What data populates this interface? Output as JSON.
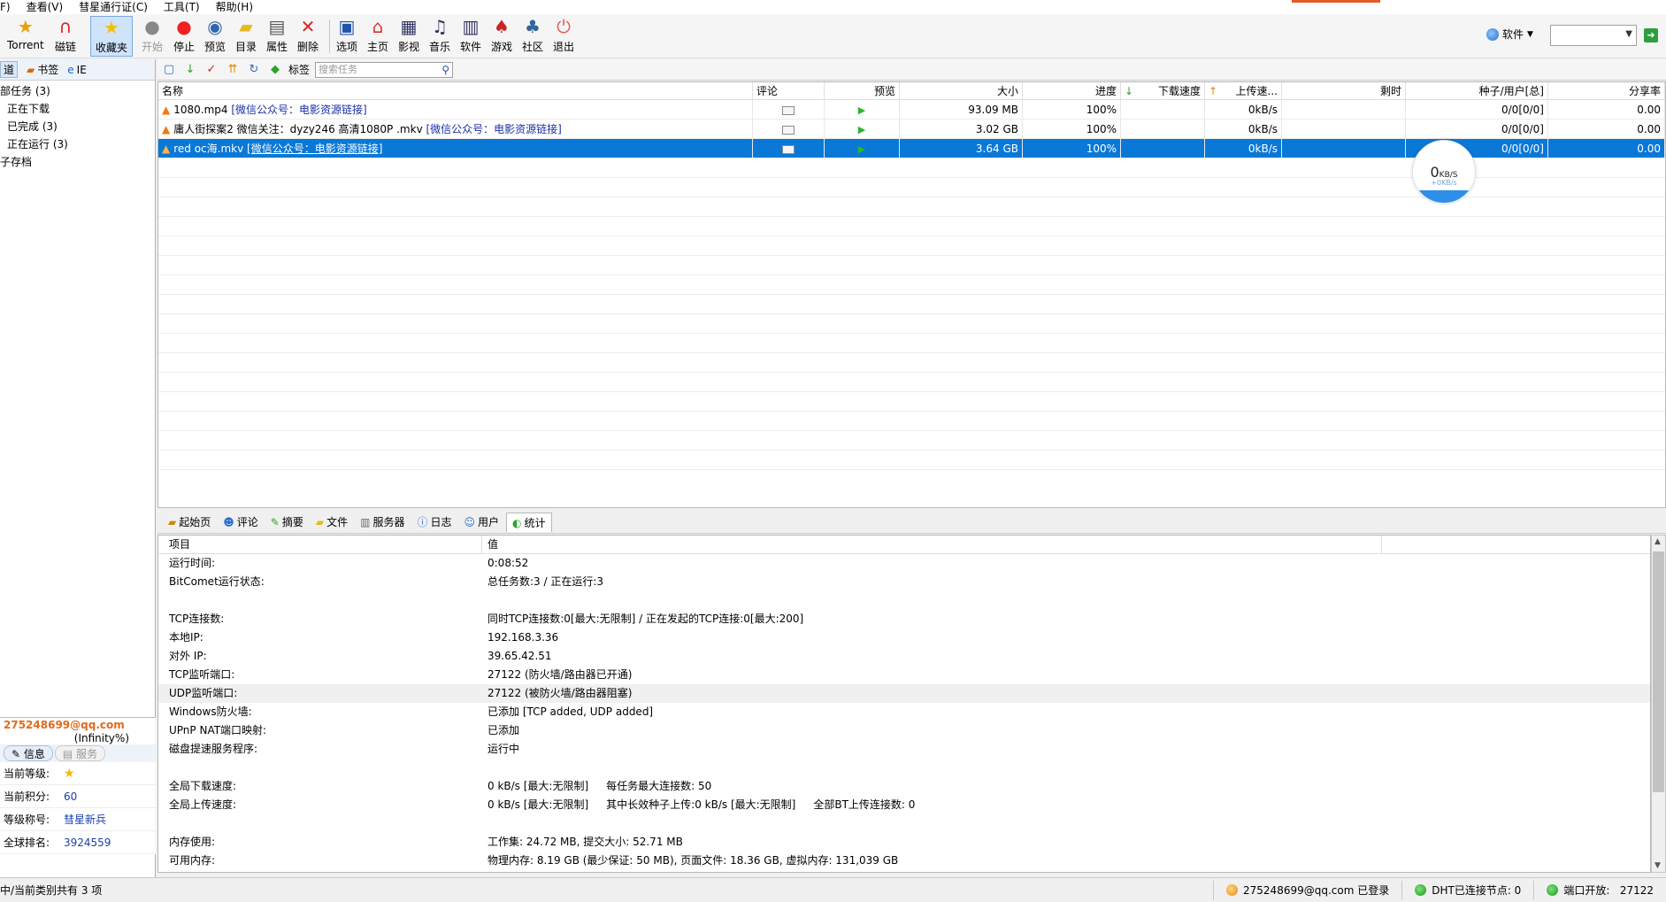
{
  "menu": {
    "items": [
      "F)",
      "查看(V)",
      "彗星通行证(C)",
      "工具(T)",
      "帮助(H)"
    ]
  },
  "toolbar": {
    "torrent": "Torrent",
    "magnet": "磁链",
    "favorites": "收藏夹",
    "start": "开始",
    "stop": "停止",
    "preview": "预览",
    "directory": "目录",
    "properties": "属性",
    "delete": "删除",
    "options": "选项",
    "home": "主页",
    "video": "影视",
    "music": "音乐",
    "software": "软件",
    "games": "游戏",
    "community": "社区",
    "exit": "退出"
  },
  "software_menu": {
    "label": "软件"
  },
  "sidebar": {
    "tabs": [
      "道",
      "书签",
      "IE"
    ],
    "tree": [
      "部任务 (3)",
      "正在下载",
      "已完成 (3)",
      "正在运行 (3)",
      "子存档"
    ]
  },
  "user": {
    "email": "275248699@qq.com",
    "infinity": "(Infinity%)",
    "tabs": {
      "info": "信息",
      "service": "服务"
    },
    "rows": [
      {
        "k": "当前等级:",
        "v": "★"
      },
      {
        "k": "当前积分:",
        "v": "60"
      },
      {
        "k": "等级称号:",
        "v": "彗星新兵"
      },
      {
        "k": "全球排名:",
        "v": "3924559"
      }
    ]
  },
  "tasktool": {
    "tags_label": "标签",
    "search_placeholder": "搜索任务"
  },
  "tasklist": {
    "columns": [
      "名称",
      "评论",
      "预览",
      "大小",
      "进度",
      "下载速度",
      "上传速...",
      "剩时",
      "种子/用户[总]",
      "分享率"
    ],
    "rows": [
      {
        "name": "1080.mp4",
        "tag": "[微信公众号：电影资源链接]",
        "size": "93.09 MB",
        "progress": "100%",
        "up": "0kB/s",
        "peers": "0/0[0/0]",
        "ratio": "0.00"
      },
      {
        "name": "庸人街探案2 微信关注：dyzy246 高清1080P .mkv",
        "tag": "[微信公众号：电影资源链接]",
        "size": "3.02 GB",
        "progress": "100%",
        "up": "0kB/s",
        "peers": "0/0[0/0]",
        "ratio": "0.00"
      },
      {
        "name": "red oc海.mkv",
        "tag": "[微信公众号：电影资源链接]",
        "size": "3.64 GB",
        "progress": "100%",
        "up": "0kB/s",
        "peers": "0/0[0/0]",
        "ratio": "0.00"
      }
    ]
  },
  "speed_bubble": {
    "value": "0",
    "unit": "KB/S",
    "sub": "+0KB/s"
  },
  "bottom_tabs": [
    "起始页",
    "评论",
    "摘要",
    "文件",
    "服务器",
    "日志",
    "用户",
    "统计"
  ],
  "stats": {
    "header": {
      "key": "项目",
      "value": "值"
    },
    "rows": [
      {
        "k": "运行时间:",
        "v": "0:08:52"
      },
      {
        "k": "BitComet运行状态:",
        "v": "总任务数:3 / 正在运行:3"
      },
      {
        "k": "",
        "v": ""
      },
      {
        "k": "TCP连接数:",
        "v": "同时TCP连接数:0[最大:无限制] / 正在发起的TCP连接:0[最大:200]"
      },
      {
        "k": "本地IP:",
        "v": "192.168.3.36"
      },
      {
        "k": "对外 IP:",
        "v": "39.65.42.51"
      },
      {
        "k": "TCP监听端口:",
        "v": "27122 (防火墙/路由器已开通)"
      },
      {
        "k": "UDP监听端口:",
        "v": "27122 (被防火墙/路由器阻塞)"
      },
      {
        "k": "Windows防火墙:",
        "v": "已添加 [TCP added, UDP added]"
      },
      {
        "k": "UPnP NAT端口映射:",
        "v": "已添加"
      },
      {
        "k": "磁盘提速服务程序:",
        "v": "运行中"
      },
      {
        "k": "",
        "v": ""
      },
      {
        "k": "全局下载速度:",
        "v": "0 kB/s [最大:无限制]",
        "v2": "每任务最大连接数: 50"
      },
      {
        "k": "全局上传速度:",
        "v": "0 kB/s [最大:无限制]",
        "v2": "其中长效种子上传:0 kB/s [最大:无限制]",
        "v3": "全部BT上传连接数: 0"
      },
      {
        "k": "",
        "v": ""
      },
      {
        "k": "内存使用:",
        "v": "工作集: 24.72 MB, 提交大小: 52.71 MB"
      },
      {
        "k": "可用内存:",
        "v": "物理内存: 8.19 GB (最少保证: 50 MB), 页面文件: 18.36 GB, 虚拟内存: 131,039 GB"
      }
    ]
  },
  "statusbar": {
    "left": "中/当前类别共有 3 项",
    "login": "275248699@qq.com 已登录",
    "dht": "DHT已连接节点: 0",
    "port": "端口开放:   27122"
  }
}
